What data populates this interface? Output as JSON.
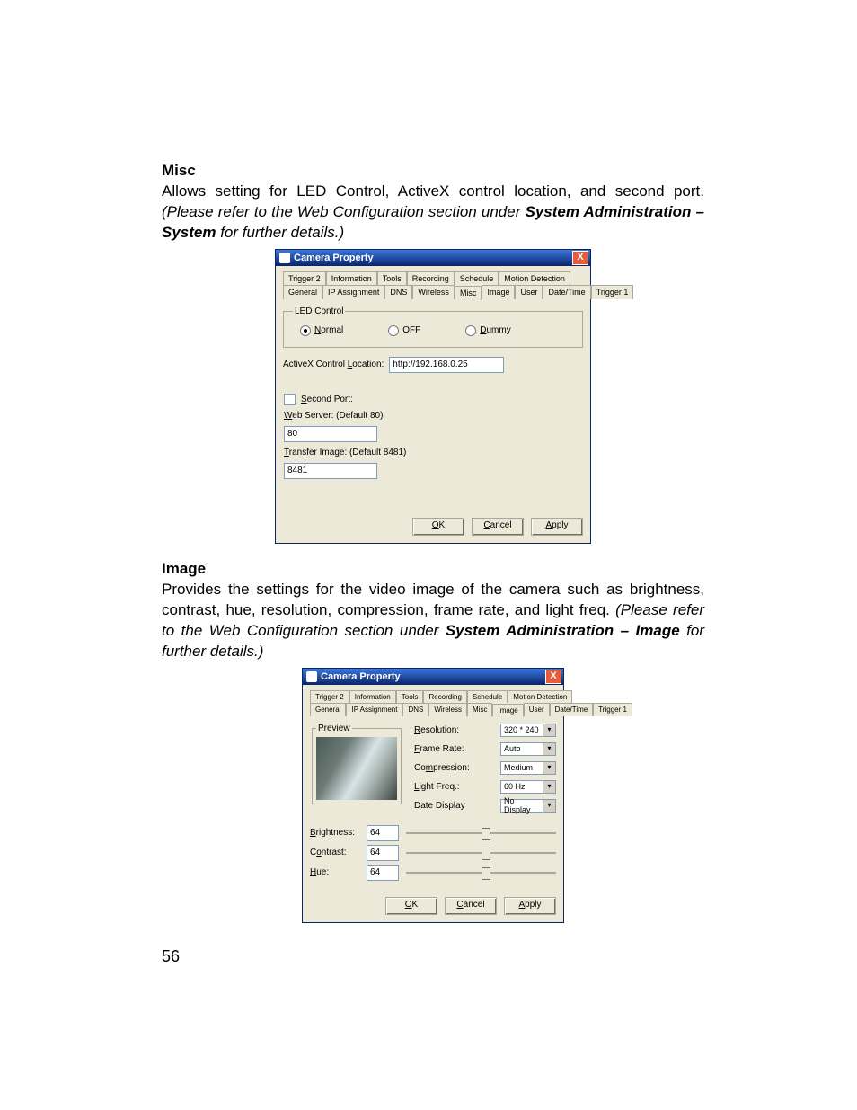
{
  "page_number": "56",
  "misc": {
    "heading": "Misc",
    "body_pre": "Allows setting for LED Control, ActiveX control location, and second port. ",
    "body_italic": "(Please refer to the Web Configuration section under ",
    "body_bold": "System Administration – System",
    "body_italic_tail": " for further details.)"
  },
  "image": {
    "heading": "Image",
    "body_pre": "Provides the settings for the video image of the camera such as brightness, contrast, hue, resolution, compression, frame rate, and light freq. ",
    "body_italic": "(Please refer to the Web Configuration section under ",
    "body_bold": "System Administration – Image",
    "body_italic_tail": " for further details.)"
  },
  "dialog": {
    "title": "Camera Property",
    "close": "X",
    "tabs_row1": [
      "Trigger 2",
      "Information",
      "Tools",
      "Recording",
      "Schedule",
      "Motion Detection"
    ],
    "tabs_row2": [
      "General",
      "IP Assignment",
      "DNS",
      "Wireless",
      "Misc",
      "Image",
      "User",
      "Date/Time",
      "Trigger 1"
    ],
    "ok": "OK",
    "cancel": "Cancel",
    "apply": "Apply"
  },
  "misc_dialog": {
    "led_legend": "LED Control",
    "radio_normal": "Normal",
    "radio_off": "OFF",
    "radio_dummy": "Dummy",
    "activex_label": "ActiveX Control Location:",
    "activex_value": "http://192.168.0.25",
    "second_port_label": "Second Port:",
    "web_server_label": "Web Server: (Default 80)",
    "web_server_value": "80",
    "transfer_label": "Transfer Image: (Default 8481)",
    "transfer_value": "8481"
  },
  "image_dialog": {
    "preview_legend": "Preview",
    "resolution_label": "Resolution:",
    "resolution_value": "320 * 240",
    "framerate_label": "Frame Rate:",
    "framerate_value": "Auto",
    "compression_label": "Compression:",
    "compression_value": "Medium",
    "lightfreq_label": "Light Freq.:",
    "lightfreq_value": "60 Hz",
    "datedisplay_label": "Date Display",
    "datedisplay_value": "No Display",
    "brightness_label": "Brightness:",
    "brightness_value": "64",
    "contrast_label": "Contrast:",
    "contrast_value": "64",
    "hue_label": "Hue:",
    "hue_value": "64"
  }
}
